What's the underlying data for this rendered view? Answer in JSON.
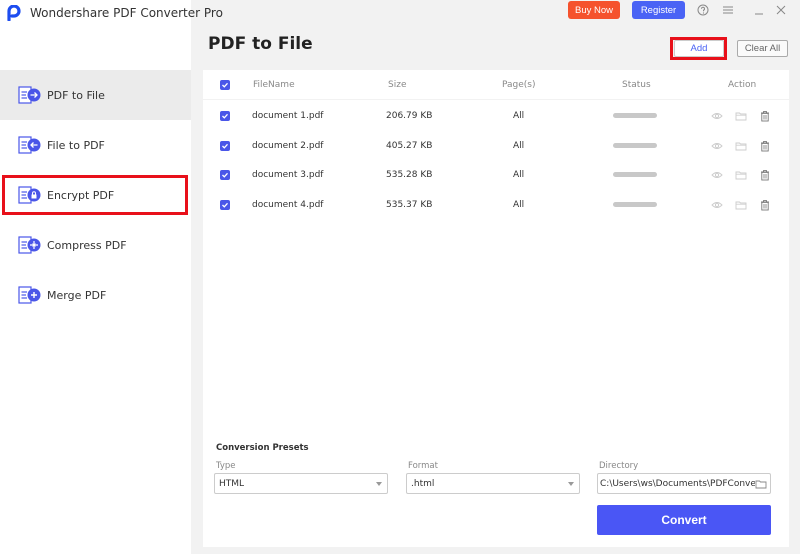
{
  "app": {
    "title": "Wondershare PDF Converter Pro",
    "brand_color": "#1d4df0"
  },
  "topbar": {
    "buy_now": "Buy Now",
    "register": "Register",
    "help_icon": "help-icon",
    "menu_icon": "menu-icon",
    "minimize_icon": "minimize-icon",
    "close_icon": "close-icon"
  },
  "sidebar": {
    "items": [
      {
        "label": "PDF to File",
        "icon": "pdf-to-file-icon",
        "active": true
      },
      {
        "label": "File to PDF",
        "icon": "file-to-pdf-icon",
        "active": false
      },
      {
        "label": "Encrypt PDF",
        "icon": "encrypt-pdf-icon",
        "active": false,
        "highlighted": true
      },
      {
        "label": "Compress PDF",
        "icon": "compress-pdf-icon",
        "active": false
      },
      {
        "label": "Merge PDF",
        "icon": "merge-pdf-icon",
        "active": false
      }
    ]
  },
  "main": {
    "title": "PDF to File",
    "add_label": "Add",
    "clear_all_label": "Clear All",
    "table": {
      "headers": {
        "filename": "FileName",
        "size": "Size",
        "pages": "Page(s)",
        "status": "Status",
        "action": "Action"
      },
      "rows": [
        {
          "name": "document 1.pdf",
          "size": "206.79 KB",
          "pages": "All",
          "checked": true
        },
        {
          "name": "document 2.pdf",
          "size": "405.27 KB",
          "pages": "All",
          "checked": true
        },
        {
          "name": "document 3.pdf",
          "size": "535.28 KB",
          "pages": "All",
          "checked": true
        },
        {
          "name": "document 4.pdf",
          "size": "535.37 KB",
          "pages": "All",
          "checked": true
        }
      ]
    },
    "presets": {
      "title": "Conversion Presets",
      "type_label": "Type",
      "type_value": "HTML",
      "format_label": "Format",
      "format_value": ".html",
      "directory_label": "Directory",
      "directory_value": "C:\\Users\\ws\\Documents\\PDFConverter"
    },
    "convert_label": "Convert"
  },
  "colors": {
    "accent": "#4a56f5",
    "buy_now": "#f5522d",
    "register": "#4a63f5",
    "highlight": "#e8101a"
  }
}
